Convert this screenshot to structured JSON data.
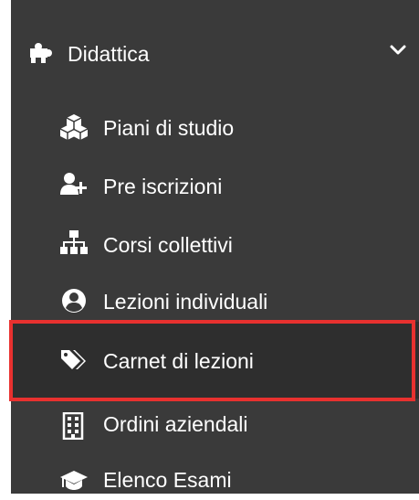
{
  "menu": {
    "header": {
      "label": "Didattica",
      "icon": "puzzle-piece-icon",
      "chevron": "chevron-down-icon"
    },
    "items": [
      {
        "label": "Piani di studio",
        "icon": "cubes-icon"
      },
      {
        "label": "Pre iscrizioni",
        "icon": "user-plus-icon"
      },
      {
        "label": "Corsi collettivi",
        "icon": "sitemap-icon"
      },
      {
        "label": "Lezioni individuali",
        "icon": "user-circle-icon"
      },
      {
        "label": "Carnet di lezioni",
        "icon": "tags-icon",
        "selected": true
      },
      {
        "label": "Ordini aziendali",
        "icon": "building-icon"
      },
      {
        "label": "Elenco Esami",
        "icon": "graduation-cap-icon"
      }
    ]
  },
  "colors": {
    "sidebar_bg": "#3a3a3a",
    "text": "#ffffff",
    "highlight_border": "#e8312f"
  }
}
